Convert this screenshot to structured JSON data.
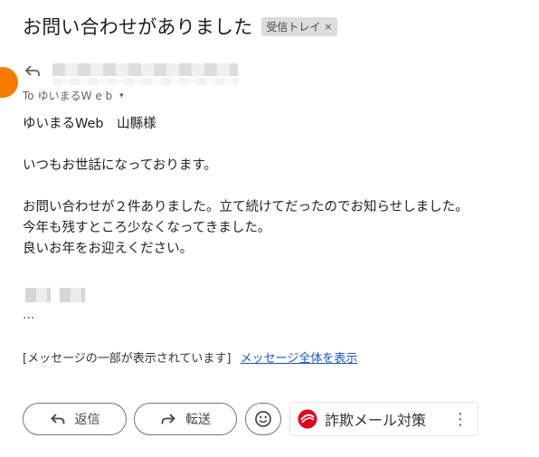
{
  "email": {
    "subject": "お問い合わせがありました",
    "label": "受信トレイ",
    "label_close": "×",
    "to_prefix": "To",
    "to_name": "ゆいまるW e b",
    "to_caret": "▾"
  },
  "body": {
    "greeting": "ゆいまるWeb　山縣様",
    "line1": "いつもお世話になっております。",
    "line2": "お問い合わせが２件ありました。立て続けてだったのでお知らせしました。",
    "line3": "今年も残すところ少なくなってきました。",
    "line4": "良いお年をお迎えください。",
    "ellipsis": "..."
  },
  "clipped": {
    "notice": "[メッセージの一部が表示されています]",
    "link": "メッセージ全体を表示"
  },
  "actions": {
    "reply": "返信",
    "forward": "転送"
  },
  "addon": {
    "label": "詐欺メール対策",
    "more": "⋮"
  },
  "colors": {
    "avatar": "#f57c00",
    "link": "#1a57c9",
    "addon_logo": "#e3001b"
  },
  "icons": {
    "reply": "reply-icon",
    "forward": "forward-icon",
    "emoji": "emoji-icon",
    "addon": "addon-logo-icon"
  }
}
